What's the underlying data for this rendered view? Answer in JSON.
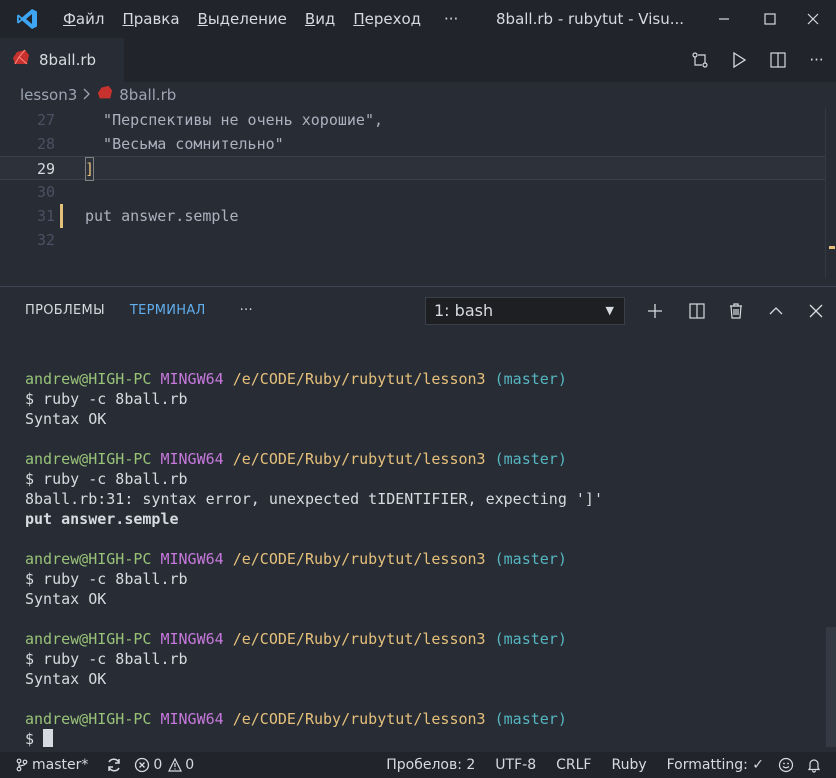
{
  "titlebar": {
    "menu": [
      "Файл",
      "Правка",
      "Выделение",
      "Вид",
      "Переход",
      "···"
    ],
    "menu_underline": [
      "Ф",
      "П",
      "В",
      "В",
      "П",
      ""
    ],
    "menu_rest": [
      "айл",
      "равка",
      "ыделение",
      "ид",
      "ереход",
      "···"
    ],
    "title": "8ball.rb - rubytut - Visu..."
  },
  "tab": {
    "label": "8ball.rb"
  },
  "breadcrumb": {
    "folder": "lesson3",
    "file": "8ball.rb"
  },
  "editor": {
    "lines": [
      {
        "num": "27",
        "code": "  \"Перспективы не очень хорошие\",",
        "kind": "str"
      },
      {
        "num": "28",
        "code": "  \"Весьма сомнительно\"",
        "kind": "str"
      },
      {
        "num": "29",
        "code": "]",
        "kind": "bracket"
      },
      {
        "num": "30",
        "code": "",
        "kind": "plain"
      },
      {
        "num": "31",
        "code": "put answer.semple",
        "kind": "plain"
      },
      {
        "num": "32",
        "code": "",
        "kind": "plain"
      }
    ]
  },
  "panel": {
    "tabs": [
      "ПРОБЛЕМЫ",
      "ТЕРМИНАЛ",
      "···"
    ],
    "terminal_select": "1: bash"
  },
  "terminal": {
    "prompt": {
      "user": "andrew@HIGH-PC",
      "host": "MINGW64",
      "path": "/e/CODE/Ruby/rubytut/lesson3",
      "branch": "(master)"
    },
    "blocks": [
      {
        "cmd": "$ ruby -c 8ball.rb",
        "out": [
          "Syntax OK"
        ]
      },
      {
        "cmd": "$ ruby -c 8ball.rb",
        "out": [
          "8ball.rb:31: syntax error, unexpected tIDENTIFIER, expecting ']'"
        ],
        "bold": "put answer.semple"
      },
      {
        "cmd": "$ ruby -c 8ball.rb",
        "out": [
          "Syntax OK"
        ]
      },
      {
        "cmd": "$ ruby -c 8ball.rb",
        "out": [
          "Syntax OK"
        ]
      }
    ],
    "last_prompt": "$ "
  },
  "statusbar": {
    "branch": "master*",
    "errors": "0",
    "warnings": "0",
    "indent": "Пробелов: 2",
    "encoding": "UTF-8",
    "eol": "CRLF",
    "language": "Ruby",
    "formatting": "Formatting: ✓"
  },
  "colors": {
    "accent": "#61afef",
    "bg": "#282c34",
    "chrome": "#21252b",
    "string": "#98c379",
    "path": "#e5c07b",
    "host": "#c678dd",
    "branch": "#56b6c2"
  }
}
